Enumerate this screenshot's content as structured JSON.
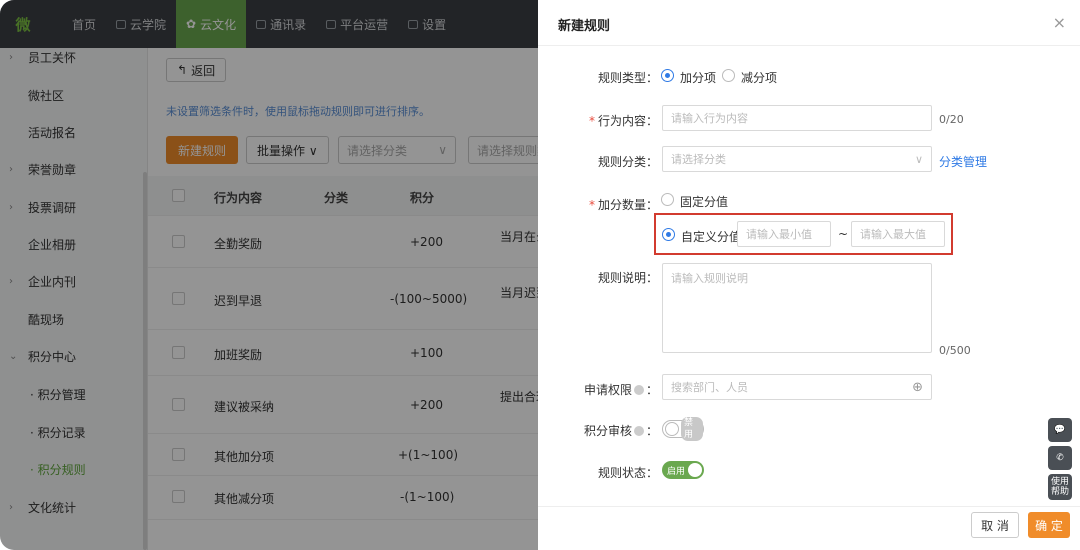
{
  "topnav": {
    "logo": "微",
    "items": [
      {
        "label": "首页"
      },
      {
        "label": "云学院"
      },
      {
        "label": "云文化"
      },
      {
        "label": "通讯录"
      },
      {
        "label": "平台运营"
      },
      {
        "label": "设置"
      }
    ]
  },
  "sidebar": {
    "items": [
      {
        "label": "员工关怀",
        "caret": "›"
      },
      {
        "label": "微社区",
        "caret": ""
      },
      {
        "label": "活动报名",
        "caret": ""
      },
      {
        "label": "荣誉勋章",
        "caret": "›"
      },
      {
        "label": "投票调研",
        "caret": "›"
      },
      {
        "label": "企业相册",
        "caret": ""
      },
      {
        "label": "企业内刊",
        "caret": "›"
      },
      {
        "label": "酷现场",
        "caret": ""
      },
      {
        "label": "积分中心",
        "caret": "⌄"
      },
      {
        "label": "· 积分管理",
        "caret": ""
      },
      {
        "label": "· 积分记录",
        "caret": ""
      },
      {
        "label": "· 积分规则",
        "caret": ""
      },
      {
        "label": "文化统计",
        "caret": "›"
      }
    ]
  },
  "main": {
    "back_label": "返回",
    "hint": "未设置筛选条件时，使用鼠标拖动规则即可进行排序。",
    "new_rule": "新建规则",
    "batch": "批量操作 ∨",
    "select_category_placeholder": "请选择分类",
    "select_rule_placeholder": "请选择规则类",
    "columns": [
      "行为内容",
      "分类",
      "积分"
    ],
    "rows": [
      {
        "content": "全勤奖励",
        "points": "+200",
        "extra": "当月在么"
      },
      {
        "content": "迟到早退",
        "points": "-(100~5000)",
        "extra": "当月迟到"
      },
      {
        "content": "加班奖励",
        "points": "+100",
        "extra": ""
      },
      {
        "content": "建议被采纳",
        "points": "+200",
        "extra": "提出合理"
      },
      {
        "content": "其他加分项",
        "points": "+(1~100)",
        "extra": ""
      },
      {
        "content": "其他减分项",
        "points": "-(1~100)",
        "extra": ""
      }
    ]
  },
  "drawer": {
    "title": "新建规则",
    "close": "×",
    "rule_type_label": "规则类型：",
    "rule_type_options": [
      "加分项",
      "减分项"
    ],
    "behavior_label": "行为内容：",
    "behavior_placeholder": "请输入行为内容",
    "behavior_counter": "0/20",
    "category_label": "规则分类：",
    "category_placeholder": "请选择分类",
    "category_manage": "分类管理",
    "amount_label": "加分数量：",
    "fixed_value": "固定分值",
    "custom_value": "自定义分值",
    "min_placeholder": "请输入最小值",
    "tilde": "~",
    "max_placeholder": "请输入最大值",
    "desc_label": "规则说明：",
    "desc_placeholder": "请输入规则说明",
    "desc_counter": "0/500",
    "permission_label": "申请权限",
    "permission_placeholder": "搜索部门、人员",
    "review_label": "积分审核",
    "review_toggle": "禁用",
    "status_label": "规则状态：",
    "status_toggle": "启用",
    "cancel": "取 消",
    "confirm": "确 定",
    "colon": "："
  },
  "float": {
    "help": "使用帮助"
  },
  "colors": {
    "accent_green": "#6aa84f",
    "primary_blue": "#2f7ae5",
    "orange": "#f08c2a",
    "highlight_red": "#d23b2f"
  }
}
